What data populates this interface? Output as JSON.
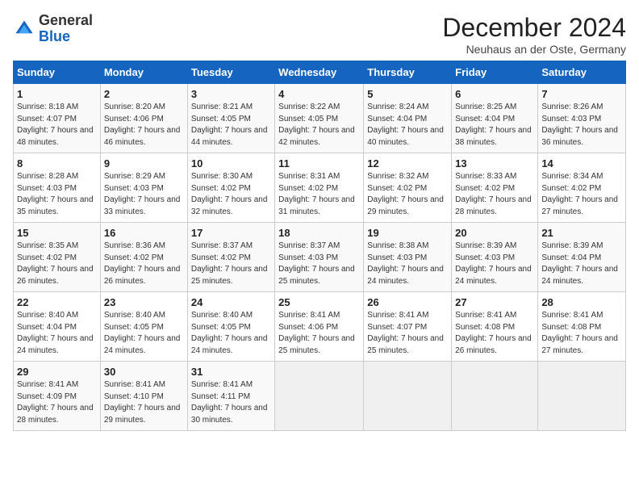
{
  "logo": {
    "general": "General",
    "blue": "Blue"
  },
  "title": "December 2024",
  "location": "Neuhaus an der Oste, Germany",
  "days_of_week": [
    "Sunday",
    "Monday",
    "Tuesday",
    "Wednesday",
    "Thursday",
    "Friday",
    "Saturday"
  ],
  "weeks": [
    [
      {
        "day": "1",
        "sunrise": "8:18 AM",
        "sunset": "4:07 PM",
        "daylight": "7 hours and 48 minutes."
      },
      {
        "day": "2",
        "sunrise": "8:20 AM",
        "sunset": "4:06 PM",
        "daylight": "7 hours and 46 minutes."
      },
      {
        "day": "3",
        "sunrise": "8:21 AM",
        "sunset": "4:05 PM",
        "daylight": "7 hours and 44 minutes."
      },
      {
        "day": "4",
        "sunrise": "8:22 AM",
        "sunset": "4:05 PM",
        "daylight": "7 hours and 42 minutes."
      },
      {
        "day": "5",
        "sunrise": "8:24 AM",
        "sunset": "4:04 PM",
        "daylight": "7 hours and 40 minutes."
      },
      {
        "day": "6",
        "sunrise": "8:25 AM",
        "sunset": "4:04 PM",
        "daylight": "7 hours and 38 minutes."
      },
      {
        "day": "7",
        "sunrise": "8:26 AM",
        "sunset": "4:03 PM",
        "daylight": "7 hours and 36 minutes."
      }
    ],
    [
      {
        "day": "8",
        "sunrise": "8:28 AM",
        "sunset": "4:03 PM",
        "daylight": "7 hours and 35 minutes."
      },
      {
        "day": "9",
        "sunrise": "8:29 AM",
        "sunset": "4:03 PM",
        "daylight": "7 hours and 33 minutes."
      },
      {
        "day": "10",
        "sunrise": "8:30 AM",
        "sunset": "4:02 PM",
        "daylight": "7 hours and 32 minutes."
      },
      {
        "day": "11",
        "sunrise": "8:31 AM",
        "sunset": "4:02 PM",
        "daylight": "7 hours and 31 minutes."
      },
      {
        "day": "12",
        "sunrise": "8:32 AM",
        "sunset": "4:02 PM",
        "daylight": "7 hours and 29 minutes."
      },
      {
        "day": "13",
        "sunrise": "8:33 AM",
        "sunset": "4:02 PM",
        "daylight": "7 hours and 28 minutes."
      },
      {
        "day": "14",
        "sunrise": "8:34 AM",
        "sunset": "4:02 PM",
        "daylight": "7 hours and 27 minutes."
      }
    ],
    [
      {
        "day": "15",
        "sunrise": "8:35 AM",
        "sunset": "4:02 PM",
        "daylight": "7 hours and 26 minutes."
      },
      {
        "day": "16",
        "sunrise": "8:36 AM",
        "sunset": "4:02 PM",
        "daylight": "7 hours and 26 minutes."
      },
      {
        "day": "17",
        "sunrise": "8:37 AM",
        "sunset": "4:02 PM",
        "daylight": "7 hours and 25 minutes."
      },
      {
        "day": "18",
        "sunrise": "8:37 AM",
        "sunset": "4:03 PM",
        "daylight": "7 hours and 25 minutes."
      },
      {
        "day": "19",
        "sunrise": "8:38 AM",
        "sunset": "4:03 PM",
        "daylight": "7 hours and 24 minutes."
      },
      {
        "day": "20",
        "sunrise": "8:39 AM",
        "sunset": "4:03 PM",
        "daylight": "7 hours and 24 minutes."
      },
      {
        "day": "21",
        "sunrise": "8:39 AM",
        "sunset": "4:04 PM",
        "daylight": "7 hours and 24 minutes."
      }
    ],
    [
      {
        "day": "22",
        "sunrise": "8:40 AM",
        "sunset": "4:04 PM",
        "daylight": "7 hours and 24 minutes."
      },
      {
        "day": "23",
        "sunrise": "8:40 AM",
        "sunset": "4:05 PM",
        "daylight": "7 hours and 24 minutes."
      },
      {
        "day": "24",
        "sunrise": "8:40 AM",
        "sunset": "4:05 PM",
        "daylight": "7 hours and 24 minutes."
      },
      {
        "day": "25",
        "sunrise": "8:41 AM",
        "sunset": "4:06 PM",
        "daylight": "7 hours and 25 minutes."
      },
      {
        "day": "26",
        "sunrise": "8:41 AM",
        "sunset": "4:07 PM",
        "daylight": "7 hours and 25 minutes."
      },
      {
        "day": "27",
        "sunrise": "8:41 AM",
        "sunset": "4:08 PM",
        "daylight": "7 hours and 26 minutes."
      },
      {
        "day": "28",
        "sunrise": "8:41 AM",
        "sunset": "4:08 PM",
        "daylight": "7 hours and 27 minutes."
      }
    ],
    [
      {
        "day": "29",
        "sunrise": "8:41 AM",
        "sunset": "4:09 PM",
        "daylight": "7 hours and 28 minutes."
      },
      {
        "day": "30",
        "sunrise": "8:41 AM",
        "sunset": "4:10 PM",
        "daylight": "7 hours and 29 minutes."
      },
      {
        "day": "31",
        "sunrise": "8:41 AM",
        "sunset": "4:11 PM",
        "daylight": "7 hours and 30 minutes."
      },
      null,
      null,
      null,
      null
    ]
  ]
}
